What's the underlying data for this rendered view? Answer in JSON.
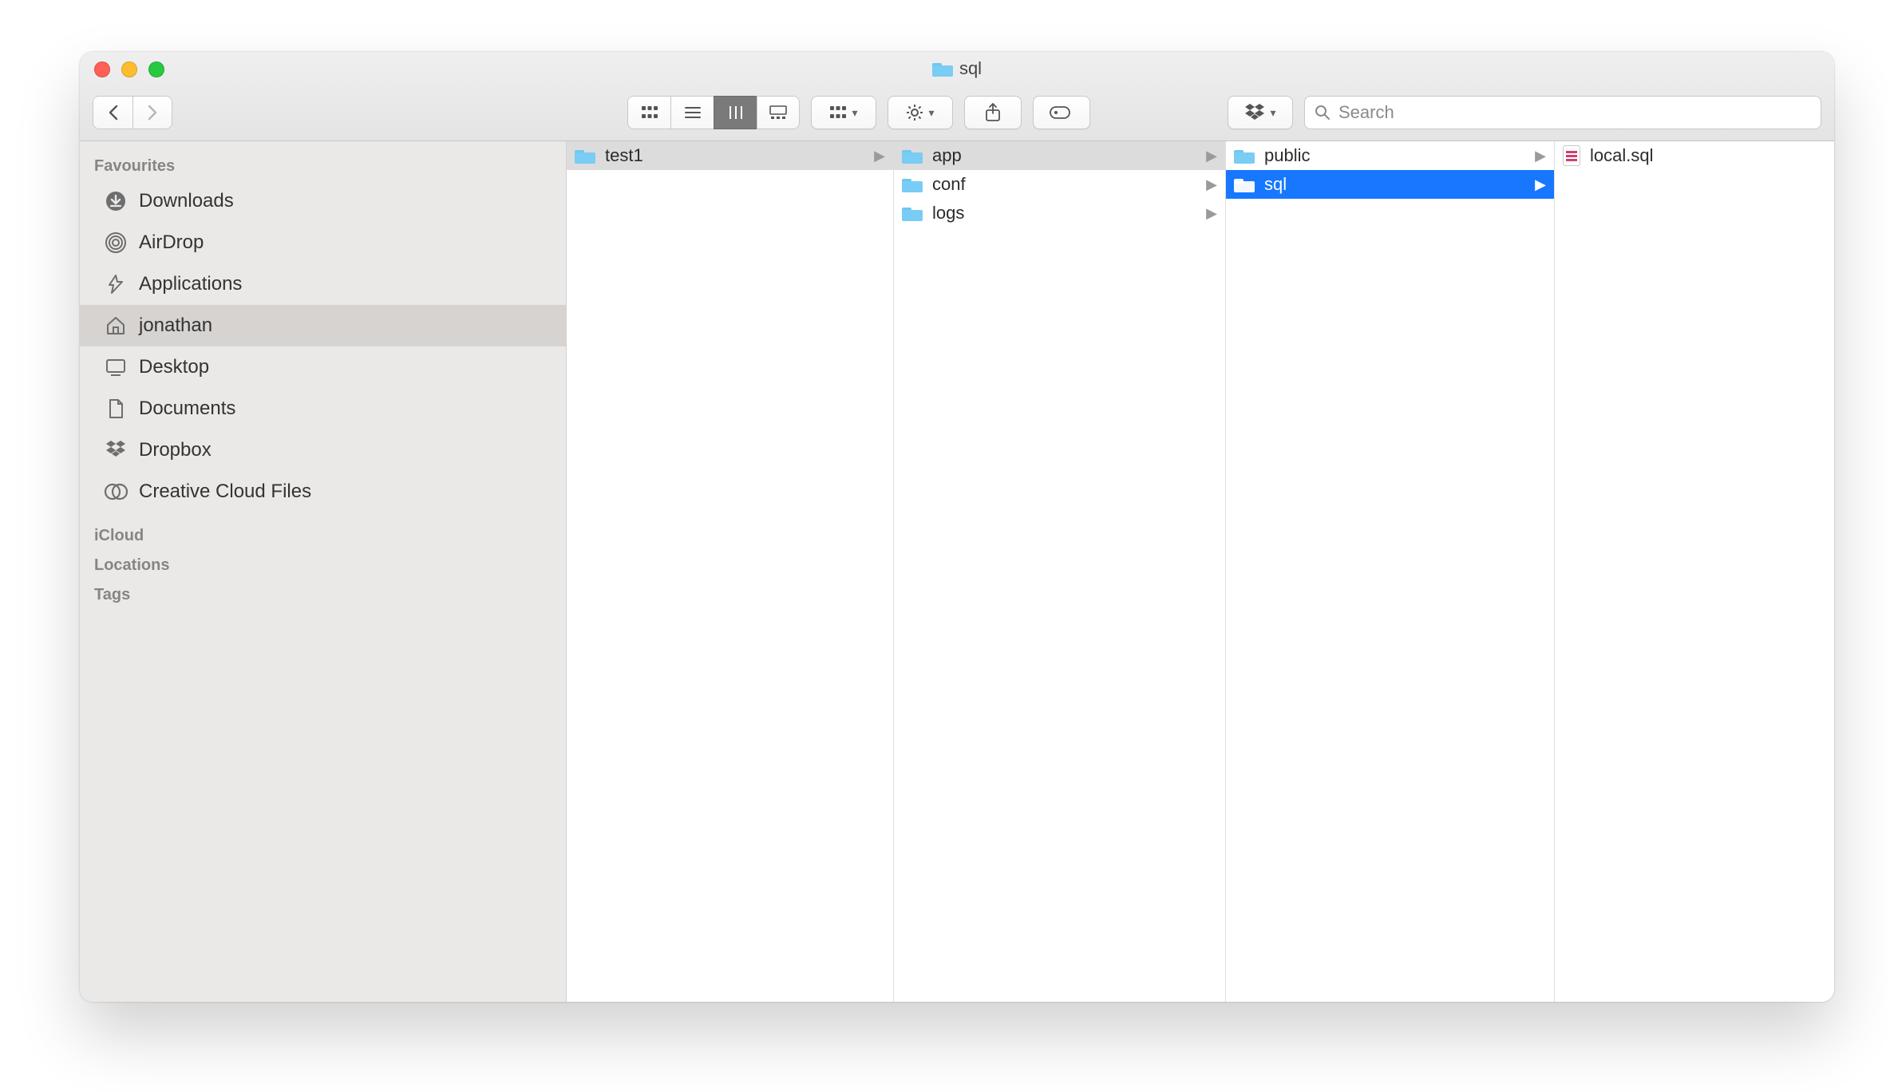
{
  "window": {
    "title": "sql"
  },
  "toolbar": {
    "search_placeholder": "Search",
    "view_mode": "columns"
  },
  "sidebar": {
    "sections": [
      {
        "header": "Favourites",
        "items": [
          {
            "icon": "download",
            "label": "Downloads",
            "selected": false
          },
          {
            "icon": "airdrop",
            "label": "AirDrop",
            "selected": false
          },
          {
            "icon": "apps",
            "label": "Applications",
            "selected": false
          },
          {
            "icon": "home",
            "label": "jonathan",
            "selected": true
          },
          {
            "icon": "desktop",
            "label": "Desktop",
            "selected": false
          },
          {
            "icon": "documents",
            "label": "Documents",
            "selected": false
          },
          {
            "icon": "dropbox",
            "label": "Dropbox",
            "selected": false
          },
          {
            "icon": "creative",
            "label": "Creative Cloud Files",
            "selected": false
          }
        ]
      },
      {
        "header": "iCloud",
        "items": []
      },
      {
        "header": "Locations",
        "items": []
      },
      {
        "header": "Tags",
        "items": []
      }
    ]
  },
  "columns": [
    {
      "items": [
        {
          "type": "folder",
          "name": "test1",
          "has_children": true,
          "in_path": true,
          "selected": false
        }
      ]
    },
    {
      "items": [
        {
          "type": "folder",
          "name": "app",
          "has_children": true,
          "in_path": true,
          "selected": false
        },
        {
          "type": "folder",
          "name": "conf",
          "has_children": true,
          "in_path": false,
          "selected": false
        },
        {
          "type": "folder",
          "name": "logs",
          "has_children": true,
          "in_path": false,
          "selected": false
        }
      ]
    },
    {
      "items": [
        {
          "type": "folder",
          "name": "public",
          "has_children": true,
          "in_path": false,
          "selected": false
        },
        {
          "type": "folder",
          "name": "sql",
          "has_children": true,
          "in_path": true,
          "selected": true
        }
      ]
    },
    {
      "items": [
        {
          "type": "file-sql",
          "name": "local.sql",
          "has_children": false,
          "in_path": false,
          "selected": false
        }
      ]
    }
  ]
}
